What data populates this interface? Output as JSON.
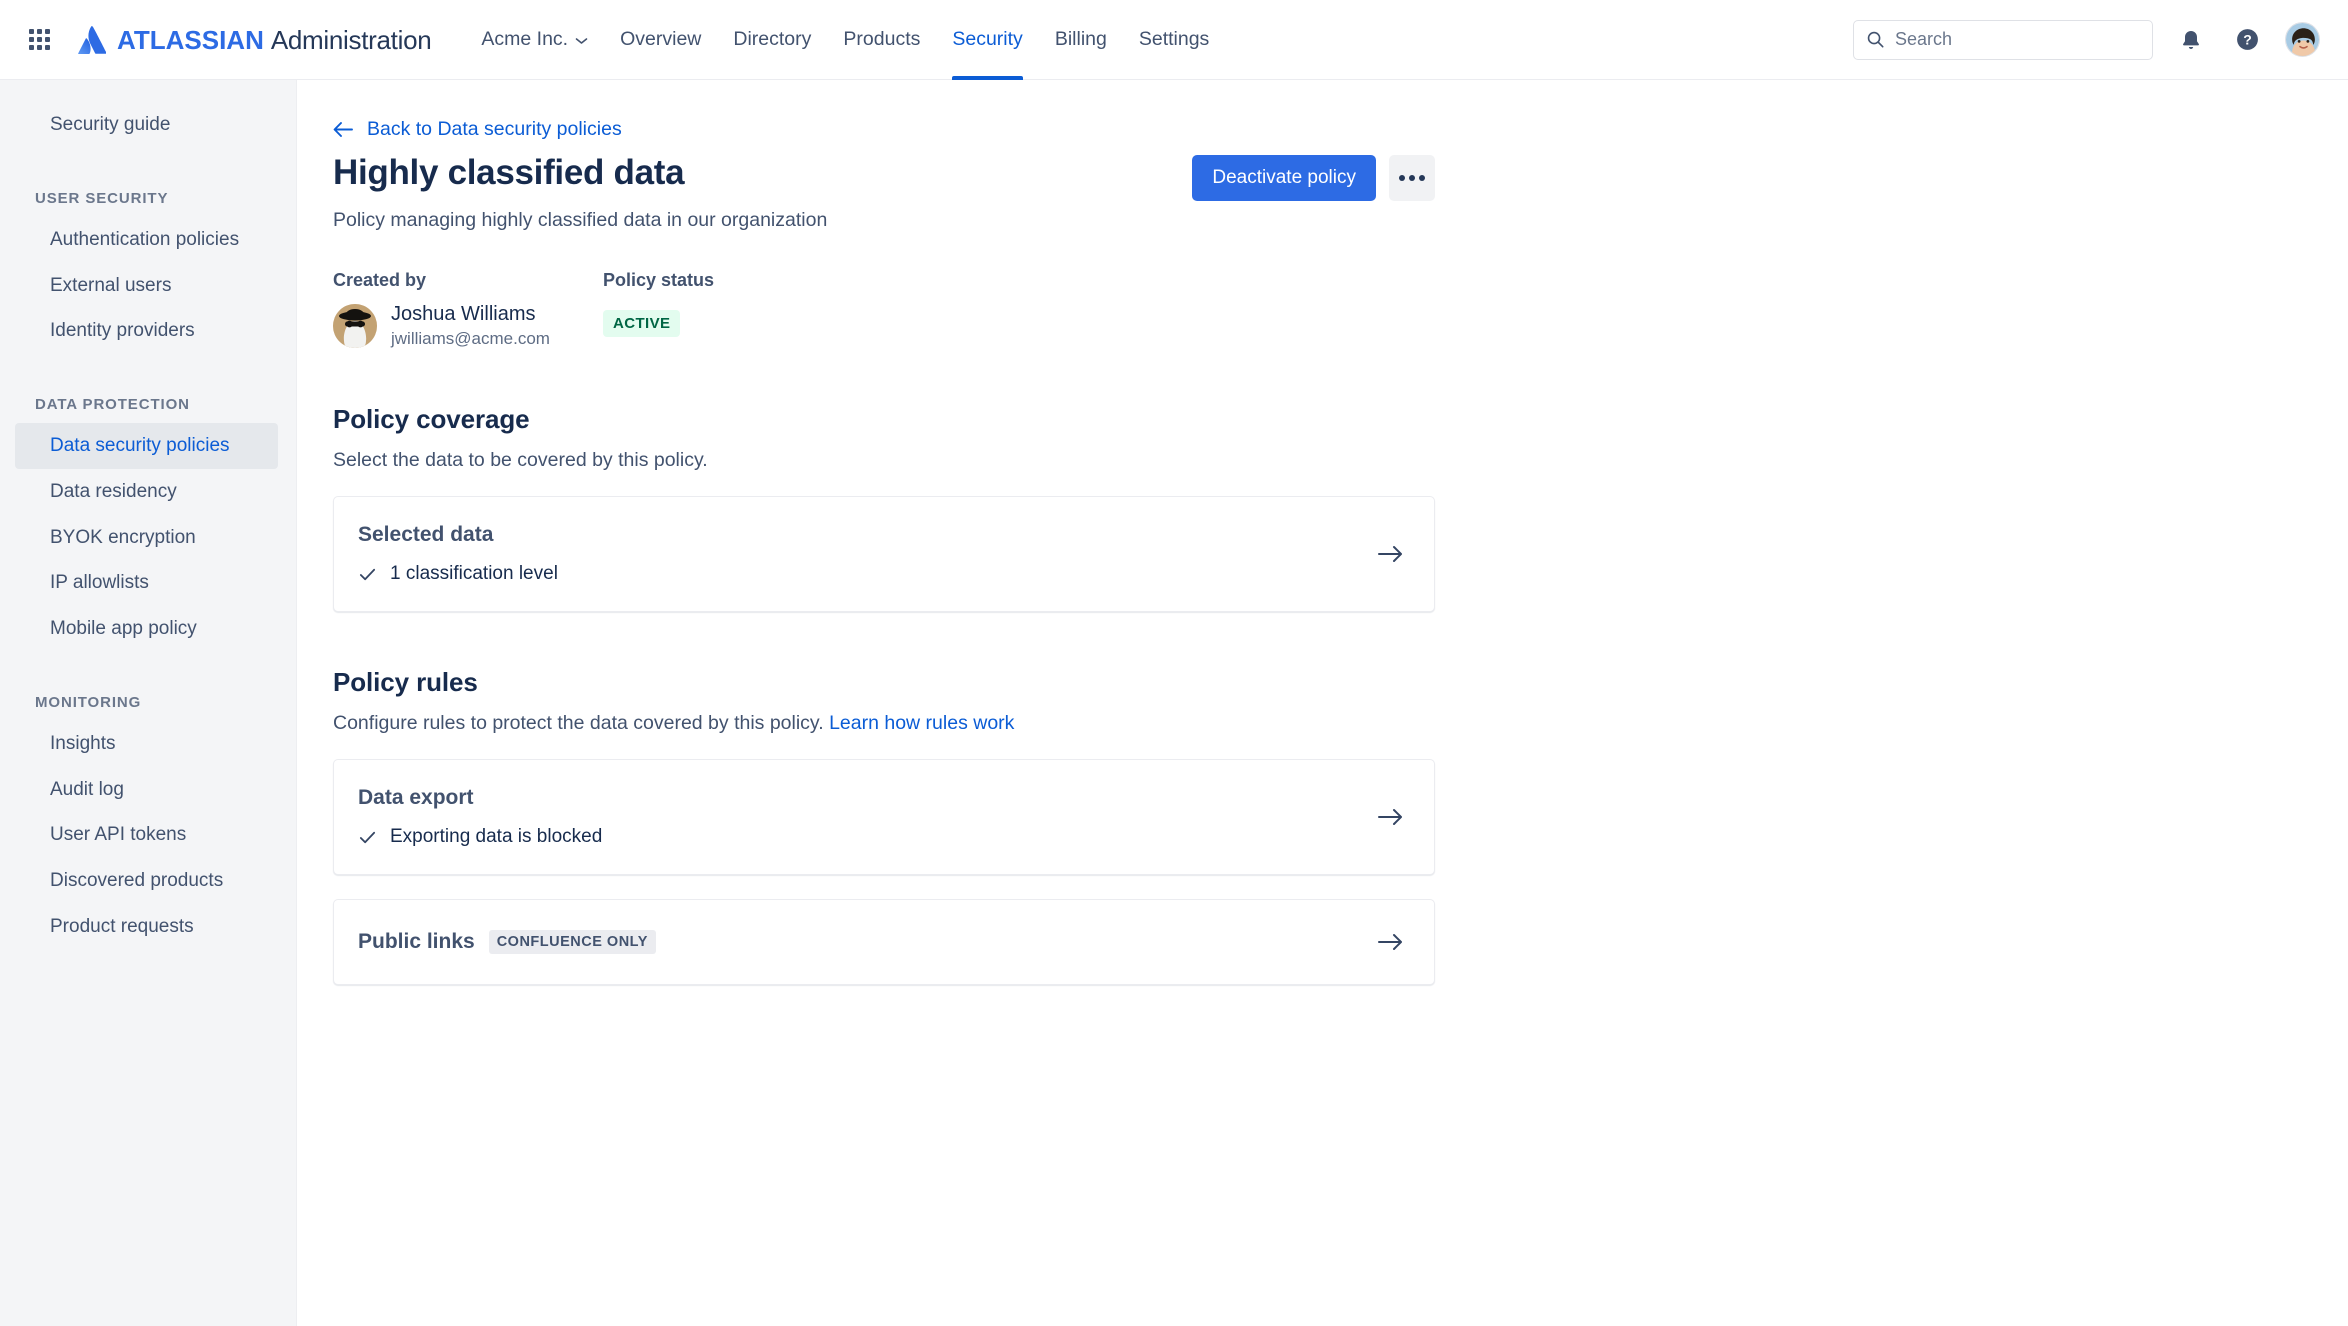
{
  "header": {
    "app_switcher_icon": "grid-apps-icon",
    "brand_logo_icon": "atlassian-logo-icon",
    "brand_primary": "ATLASSIAN",
    "brand_secondary": "Administration",
    "org_name": "Acme Inc.",
    "org_chevron_icon": "chevron-down-icon",
    "nav_items": [
      {
        "label": "Overview",
        "active": false
      },
      {
        "label": "Directory",
        "active": false
      },
      {
        "label": "Products",
        "active": false
      },
      {
        "label": "Security",
        "active": true
      },
      {
        "label": "Billing",
        "active": false
      },
      {
        "label": "Settings",
        "active": false
      }
    ],
    "search_placeholder": "Search",
    "search_value": "",
    "search_icon": "search-icon",
    "notifications_icon": "bell-icon",
    "help_icon": "help-circle-icon",
    "profile_avatar_icon": "user-avatar",
    "active_accent_color": "#0B5CD5"
  },
  "sidebar": {
    "top_items": [
      {
        "label": "Security guide",
        "selected": false
      }
    ],
    "groups": [
      {
        "heading": "USER SECURITY",
        "items": [
          {
            "label": "Authentication policies",
            "selected": false
          },
          {
            "label": "External users",
            "selected": false
          },
          {
            "label": "Identity providers",
            "selected": false
          }
        ]
      },
      {
        "heading": "DATA PROTECTION",
        "items": [
          {
            "label": "Data security policies",
            "selected": true
          },
          {
            "label": "Data residency",
            "selected": false
          },
          {
            "label": "BYOK encryption",
            "selected": false
          },
          {
            "label": "IP allowlists",
            "selected": false
          },
          {
            "label": "Mobile app policy",
            "selected": false
          }
        ]
      },
      {
        "heading": "MONITORING",
        "items": [
          {
            "label": "Insights",
            "selected": false
          },
          {
            "label": "Audit log",
            "selected": false
          },
          {
            "label": "User API tokens",
            "selected": false
          },
          {
            "label": "Discovered products",
            "selected": false
          },
          {
            "label": "Product requests",
            "selected": false
          }
        ]
      }
    ],
    "selected_bg_color": "#E5E8EC",
    "selected_text_color": "#0B5CD5"
  },
  "main": {
    "back_link": "Back to Data security policies",
    "back_icon": "arrow-left-icon",
    "title": "Highly classified data",
    "description": "Policy managing highly classified data in our organization",
    "primary_action": "Deactivate policy",
    "primary_action_color": "#2D6BE4",
    "more_actions_icon": "more-horizontal-icon",
    "created_by_label": "Created by",
    "creator_name": "Joshua Williams",
    "creator_email": "jwilliams@acme.com",
    "creator_avatar_icon": "user-avatar",
    "policy_status_label": "Policy status",
    "policy_status_value": "ACTIVE",
    "policy_status_bg": "#E3FCEF",
    "policy_status_color": "#006644",
    "coverage": {
      "title": "Policy coverage",
      "description": "Select the data to be covered by this policy.",
      "cards": [
        {
          "title": "Selected data",
          "detail": "1 classification level",
          "check_icon": "check-icon",
          "arrow_icon": "arrow-right-icon"
        }
      ]
    },
    "rules": {
      "title": "Policy rules",
      "description": "Configure rules to protect the data covered by this policy.",
      "link_text": "Learn how rules work",
      "cards": [
        {
          "title": "Data export",
          "detail": "Exporting data is blocked",
          "badge": "",
          "check_icon": "check-icon",
          "arrow_icon": "arrow-right-icon"
        },
        {
          "title": "Public links",
          "detail": "",
          "badge": "CONFLUENCE ONLY",
          "check_icon": "",
          "arrow_icon": "arrow-right-icon"
        }
      ]
    }
  }
}
